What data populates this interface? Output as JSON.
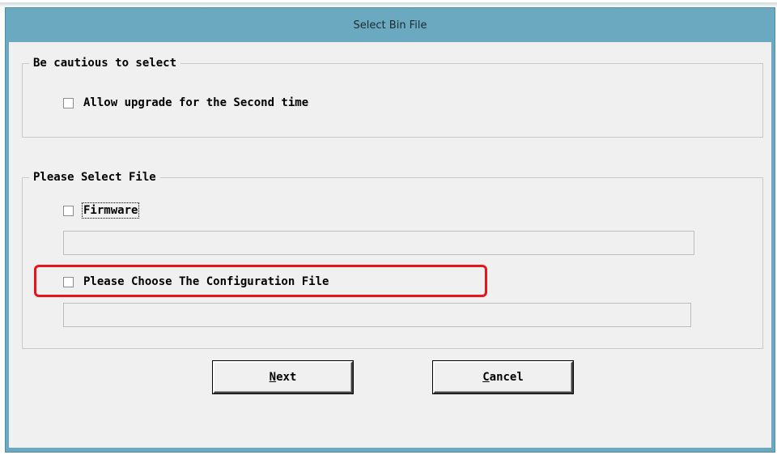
{
  "window": {
    "title": "Select Bin File"
  },
  "caution_group": {
    "legend": "Be cautious to select",
    "allow_second_upgrade": {
      "label": "Allow upgrade for the Second time",
      "checked": false
    }
  },
  "file_group": {
    "legend": "Please Select File",
    "firmware": {
      "label": "Firmware",
      "checked": false,
      "path": ""
    },
    "config": {
      "label": "Please Choose The Configuration File",
      "checked": false,
      "path": ""
    }
  },
  "buttons": {
    "next": {
      "mnemonic": "N",
      "rest": "ext"
    },
    "cancel": {
      "mnemonic": "C",
      "rest": "ancel"
    }
  },
  "colors": {
    "title_bar": "#6aa9bf",
    "client": "#f0f0f0",
    "highlight": "#e8141b"
  }
}
